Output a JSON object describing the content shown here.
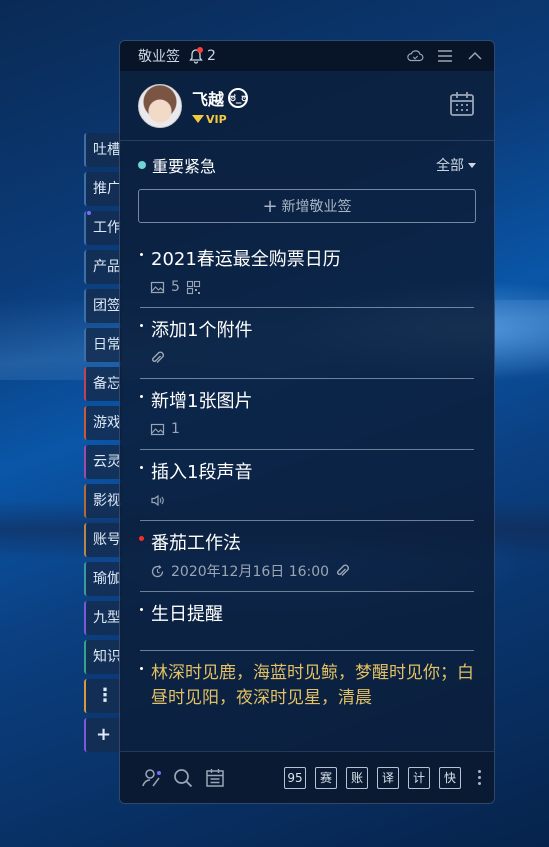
{
  "side_tabs": [
    {
      "label": "吐槽",
      "dot": null
    },
    {
      "label": "推广",
      "dot": null
    },
    {
      "label": "工作",
      "dot": "#7a6bff"
    },
    {
      "label": "产品",
      "dot": null
    },
    {
      "label": "团签",
      "dot": null
    },
    {
      "label": "日常",
      "dot": null
    },
    {
      "label": "备忘",
      "dot": null
    },
    {
      "label": "游戏",
      "dot": null
    },
    {
      "label": "云灵",
      "dot": null
    },
    {
      "label": "影视",
      "dot": null
    },
    {
      "label": "账号",
      "dot": null
    },
    {
      "label": "瑜伽",
      "dot": null
    },
    {
      "label": "九型",
      "dot": null
    },
    {
      "label": "知识",
      "dot": null
    },
    {
      "label": "⋮",
      "dot": null
    },
    {
      "label": "+",
      "dot": null
    }
  ],
  "titlebar": {
    "app_name": "敬业签",
    "notification_count": "2"
  },
  "user": {
    "name": "飞越",
    "badge": "VIP"
  },
  "category": {
    "name": "重要紧急",
    "dot_color": "#6fd4d4",
    "filter": "全部"
  },
  "new_button": {
    "label": "新增敬业签"
  },
  "notes": [
    {
      "title": "2021春运最全购票日历",
      "images": "5"
    },
    {
      "title": "添加1个附件"
    },
    {
      "title": "新增1张图片",
      "images": "1"
    },
    {
      "title": "插入1段声音"
    },
    {
      "title": "番茄工作法",
      "reminder": "2020年12月16日 16:00"
    },
    {
      "title": "生日提醒"
    },
    {
      "title": "林深时见鹿，海蓝时见鲸，梦醒时见你；白昼时见阳，夜深时见星，清晨"
    }
  ],
  "bottom": {
    "quick": [
      "95",
      "赛",
      "账",
      "译",
      "计",
      "快"
    ]
  },
  "colors": {
    "accent_red": "#ff2a2a",
    "gold_text": "#e2c063"
  }
}
